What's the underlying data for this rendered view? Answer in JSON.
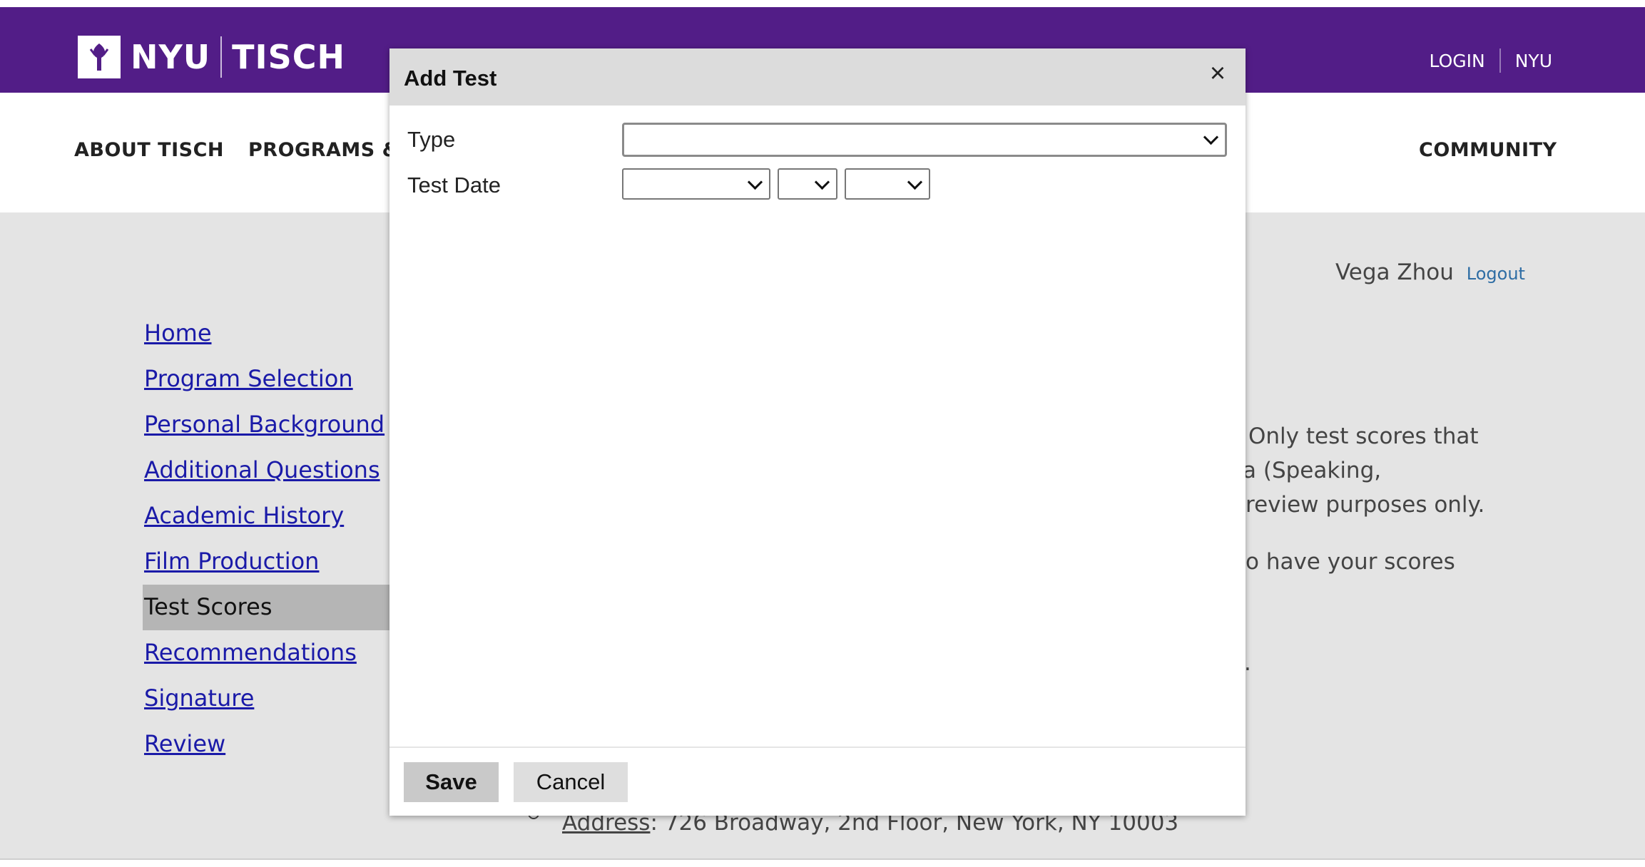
{
  "header": {
    "logo_text_left": "NYU",
    "logo_text_right": "TISCH",
    "login_label": "LOGIN",
    "nyu_label": "NYU",
    "brand_color": "#521d87"
  },
  "mainnav": {
    "items": [
      "ABOUT TISCH",
      "PROGRAMS & D",
      "COMMUNITY"
    ]
  },
  "user": {
    "name": "Vega Zhou",
    "logout_label": "Logout"
  },
  "sidebar": {
    "items": [
      {
        "label": "Home"
      },
      {
        "label": "Program Selection"
      },
      {
        "label": "Personal Background"
      },
      {
        "label": "Additional Questions"
      },
      {
        "label": "Academic History"
      },
      {
        "label": "Film Production"
      },
      {
        "label": "Test Scores",
        "active": true
      },
      {
        "label": "Recommendations"
      },
      {
        "label": "Signature"
      },
      {
        "label": "Review"
      }
    ]
  },
  "page_text": {
    "line1": "Only test scores that",
    "line2": "a (Speaking,",
    "line3": "review purposes only.",
    "line4": "o have your scores",
    "line5": ".",
    "address_label": "Address",
    "address_value": ": 726 Broadway, 2nd Floor, New York, NY 10003"
  },
  "modal": {
    "title": "Add Test",
    "close_icon": "close-icon",
    "type_label": "Type",
    "type_value": "",
    "test_date_label": "Test Date",
    "month_value": "",
    "day_value": "",
    "year_value": "",
    "save_label": "Save",
    "cancel_label": "Cancel"
  }
}
